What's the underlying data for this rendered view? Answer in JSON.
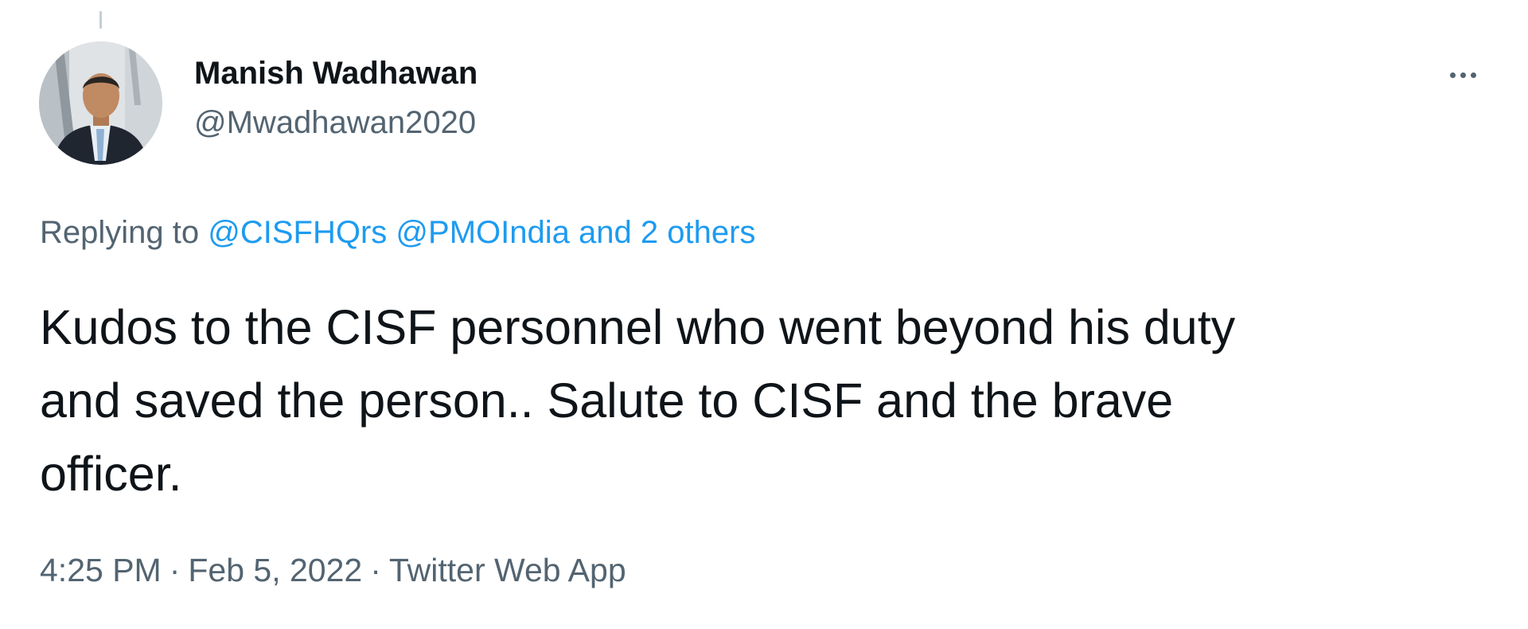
{
  "tweet": {
    "author": {
      "display_name": "Manish Wadhawan",
      "handle": "@Mwadhawan2020",
      "avatar_icon": "profile-photo"
    },
    "more_icon": "more-horizontal-icon",
    "replying": {
      "prefix": "Replying to ",
      "mentions": [
        "@CISFHQrs",
        "@PMOIndia"
      ],
      "others": "and 2 others"
    },
    "text": "Kudos to the CISF personnel who went beyond his duty\nand saved the person.. Salute to CISF and the brave\nofficer.",
    "meta": {
      "time": "4:25 PM",
      "date": "Feb 5, 2022",
      "source": "Twitter Web App",
      "separator": "·"
    },
    "colors": {
      "link": "#1d9bf0",
      "secondary": "#536471",
      "primary": "#0f1419"
    }
  }
}
